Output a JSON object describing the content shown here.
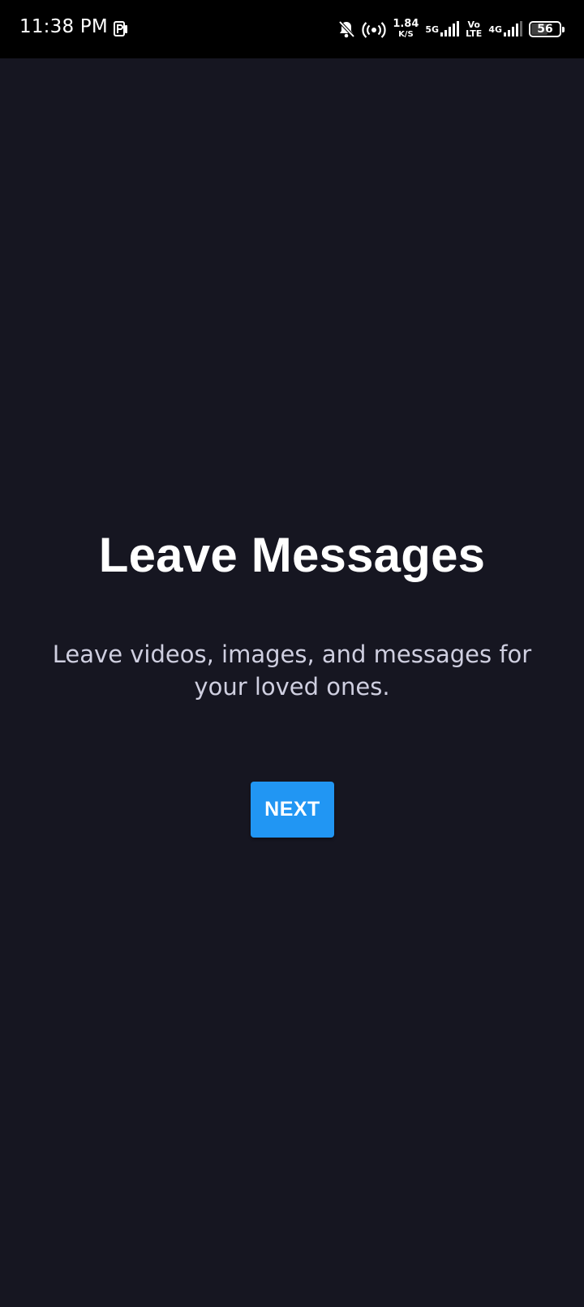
{
  "status_bar": {
    "time": "11:38 PM",
    "net_speed_value": "1.84",
    "net_speed_unit": "K/S",
    "network_5g": "5G",
    "volte_top": "Vo",
    "volte_bottom": "LTE",
    "network_4g": "4G",
    "battery_level": "56",
    "icons": [
      "parking-app-icon",
      "notifications-off-icon",
      "hotspot-icon",
      "signal-5g-icon",
      "volte-icon",
      "signal-4g-icon",
      "battery-icon"
    ]
  },
  "onboarding": {
    "title": "Leave Messages",
    "subtitle": "Leave videos, images, and messages for your loved ones.",
    "next_label": "NEXT"
  },
  "colors": {
    "background": "#161621",
    "status_bar": "#000000",
    "accent": "#2196F3",
    "title": "#ffffff",
    "subtitle": "#cfcfe0"
  }
}
